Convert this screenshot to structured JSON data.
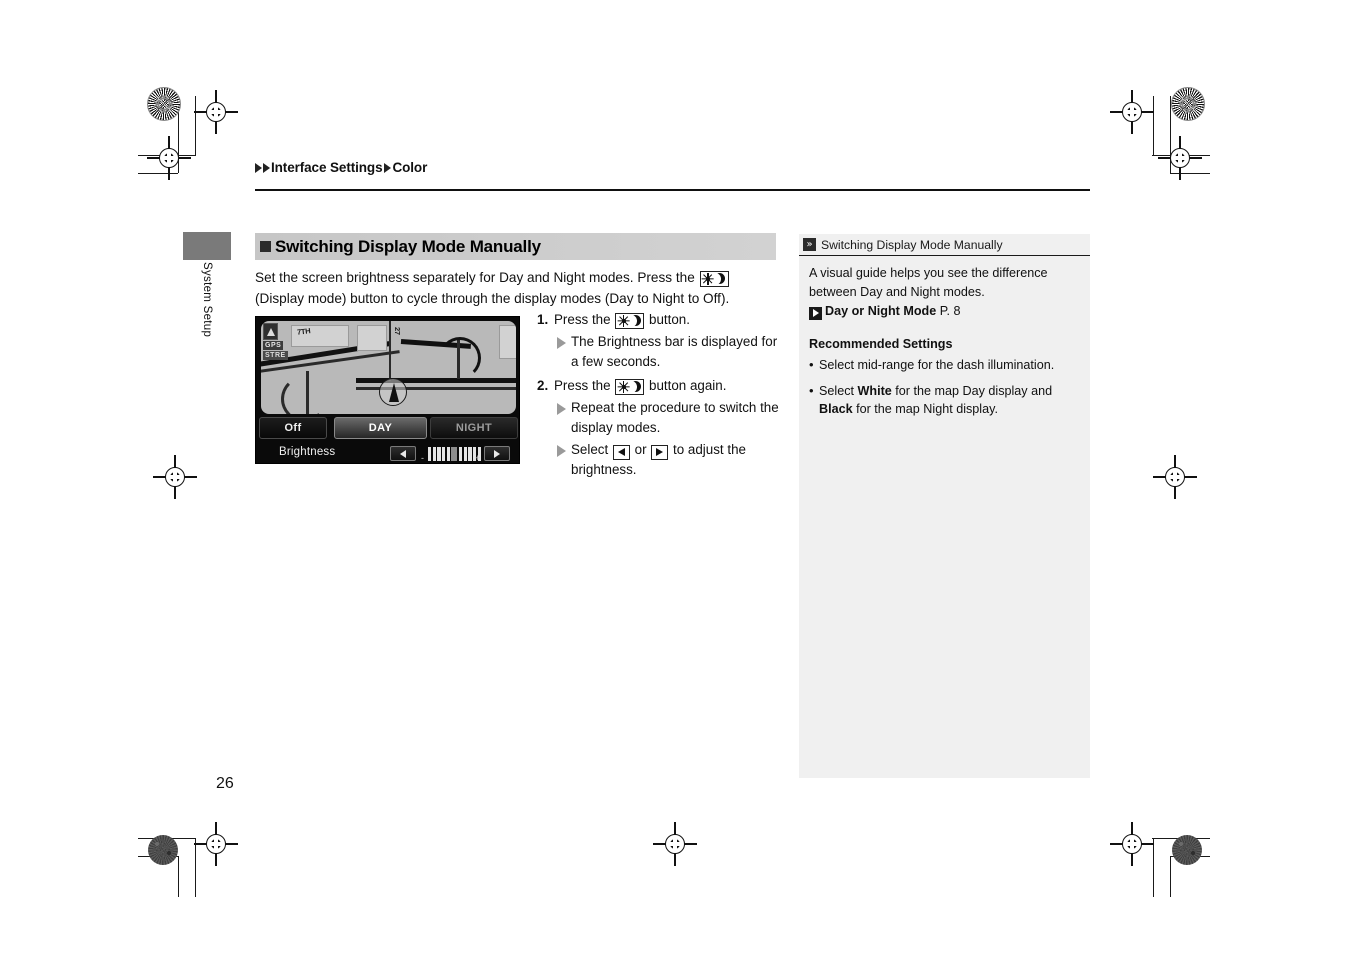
{
  "breadcrumb": {
    "level1": "Interface Settings",
    "level2": "Color",
    "arrow1_icon": "triangle-right-icon",
    "arrow2_icon": "triangle-right-icon",
    "arrow3_icon": "triangle-right-icon"
  },
  "side_tab": {
    "label": "System Setup"
  },
  "section": {
    "heading": "Switching Display Mode Manually",
    "bullet_icon": "filled-square-icon",
    "band_color": "#cccccc"
  },
  "intro": {
    "part1": "Set the screen brightness separately for Day and Night modes. Press the ",
    "icon": "day-night-display-mode-icon",
    "part2": " (Display mode) button to cycle through the display modes (Day to Night to Off)."
  },
  "nav_screenshot": {
    "map": {
      "street_label_1": "7TH",
      "street_label_2": "27",
      "gps_badge": "GPS",
      "status_badge": "STRE",
      "compass_icon": "north-arrow-icon",
      "vehicle_icon": "vehicle-position-icon"
    },
    "mode_buttons": [
      {
        "label": "Off",
        "selected": false
      },
      {
        "label": "DAY",
        "selected": true
      },
      {
        "label": "NIGHT",
        "selected": false
      }
    ],
    "brightness": {
      "label": "Brightness",
      "left_arrow_icon": "arrow-left-icon",
      "right_arrow_icon": "arrow-right-icon",
      "segments": 10,
      "cursor_index": 5
    }
  },
  "steps": [
    {
      "number": "1.",
      "text_before": "Press the ",
      "icon": "day-night-display-mode-icon",
      "text_after": " button.",
      "subs": [
        {
          "icon": "triangle-right-icon",
          "text": "The Brightness bar is displayed for a few seconds."
        }
      ]
    },
    {
      "number": "2.",
      "text_before": "Press the ",
      "icon": "day-night-display-mode-icon",
      "text_after": " button again.",
      "subs": [
        {
          "icon": "triangle-right-icon",
          "text": "Repeat the procedure to switch the display modes."
        },
        {
          "icon": "triangle-right-icon",
          "text_before": "Select ",
          "icon_left": "arrow-left-icon",
          "text_mid": " or ",
          "icon_right": "arrow-right-icon",
          "text_after": " to adjust the brightness."
        }
      ]
    }
  ],
  "sidebar": {
    "header_icon": "double-chevron-right-icon",
    "header_title": "Switching Display Mode Manually",
    "paragraph": "A visual guide helps you see the difference between Day and Night modes.",
    "reference": {
      "icon": "jump-link-icon",
      "title": "Day or Night Mode",
      "page": "P. 8"
    },
    "recommended_title": "Recommended Settings",
    "bullets": [
      {
        "text": "Select mid-range for the dash illumination."
      },
      {
        "text_before": "Select ",
        "bold1": "White",
        "text_mid": " for the map Day display and ",
        "bold2": "Black",
        "text_after": " for the map Night display."
      }
    ],
    "background_color": "#f0f0f0"
  },
  "footer": {
    "page_number": "26"
  }
}
